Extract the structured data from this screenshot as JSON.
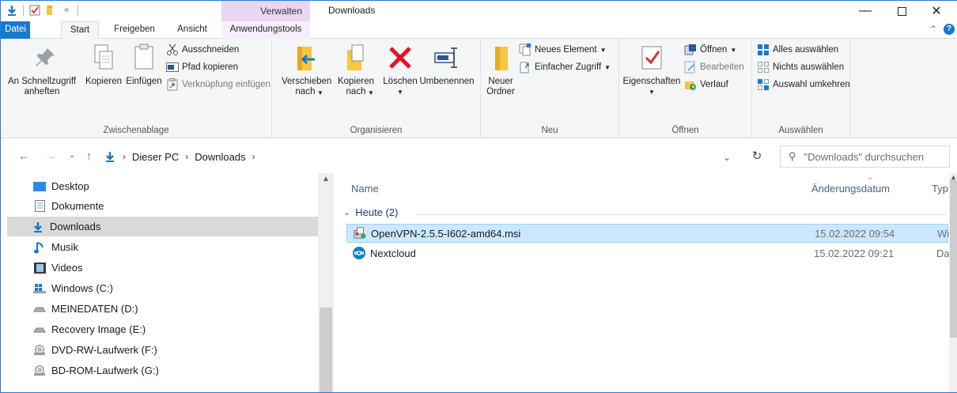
{
  "window": {
    "title": "Downloads",
    "context_tab_group": "Verwalten"
  },
  "tabs": [
    {
      "label": "Datei"
    },
    {
      "label": "Start"
    },
    {
      "label": "Freigeben"
    },
    {
      "label": "Ansicht"
    },
    {
      "label": "Anwendungstools"
    }
  ],
  "ribbon": {
    "clipboard": {
      "label": "Zwischenablage",
      "pin": "An Schnellzugriff anheften",
      "copy": "Kopieren",
      "paste": "Einfügen",
      "cut": "Ausschneiden",
      "copy_path": "Pfad kopieren",
      "paste_shortcut": "Verknüpfung einfügen"
    },
    "organize": {
      "label": "Organisieren",
      "move_to": "Verschieben nach",
      "copy_to": "Kopieren nach",
      "delete": "Löschen",
      "rename": "Umbenennen"
    },
    "new": {
      "label": "Neu",
      "new_folder": "Neuer Ordner",
      "new_item": "Neues Element",
      "easy_access": "Einfacher Zugriff"
    },
    "open": {
      "label": "Öffnen",
      "properties": "Eigenschaften",
      "open": "Öffnen",
      "edit": "Bearbeiten",
      "history": "Verlauf"
    },
    "select": {
      "label": "Auswählen",
      "select_all": "Alles auswählen",
      "select_none": "Nichts auswählen",
      "invert": "Auswahl umkehren"
    }
  },
  "address": {
    "crumbs": [
      "Dieser PC",
      "Downloads"
    ],
    "search_placeholder": "\"Downloads\" durchsuchen"
  },
  "nav": {
    "items": [
      {
        "label": "Desktop",
        "icon": "desktop-icon"
      },
      {
        "label": "Dokumente",
        "icon": "documents-icon"
      },
      {
        "label": "Downloads",
        "icon": "downloads-icon",
        "selected": true
      },
      {
        "label": "Musik",
        "icon": "music-icon"
      },
      {
        "label": "Videos",
        "icon": "videos-icon"
      },
      {
        "label": "Windows (C:)",
        "icon": "windows-drive-icon"
      },
      {
        "label": "MEINEDATEN (D:)",
        "icon": "drive-icon"
      },
      {
        "label": "Recovery Image (E:)",
        "icon": "drive-icon"
      },
      {
        "label": "DVD-RW-Laufwerk (F:)",
        "icon": "dvd-drive-icon"
      },
      {
        "label": "BD-ROM-Laufwerk (G:)",
        "icon": "bd-drive-icon"
      }
    ]
  },
  "files": {
    "columns": {
      "name": "Name",
      "date": "Änderungsdatum",
      "type": "Typ"
    },
    "group": "Heute (2)",
    "rows": [
      {
        "name": "OpenVPN-2.5.5-I602-amd64.msi",
        "date": "15.02.2022 09:54",
        "type": "Wi",
        "icon": "msi-installer-icon",
        "selected": true
      },
      {
        "name": "Nextcloud",
        "date": "15.02.2022 09:21",
        "type": "Da",
        "icon": "nextcloud-icon",
        "selected": false
      }
    ]
  },
  "colors": {
    "accent": "#1979ca",
    "selection": "#cce8ff",
    "context_tab": "#e9d6f3"
  }
}
